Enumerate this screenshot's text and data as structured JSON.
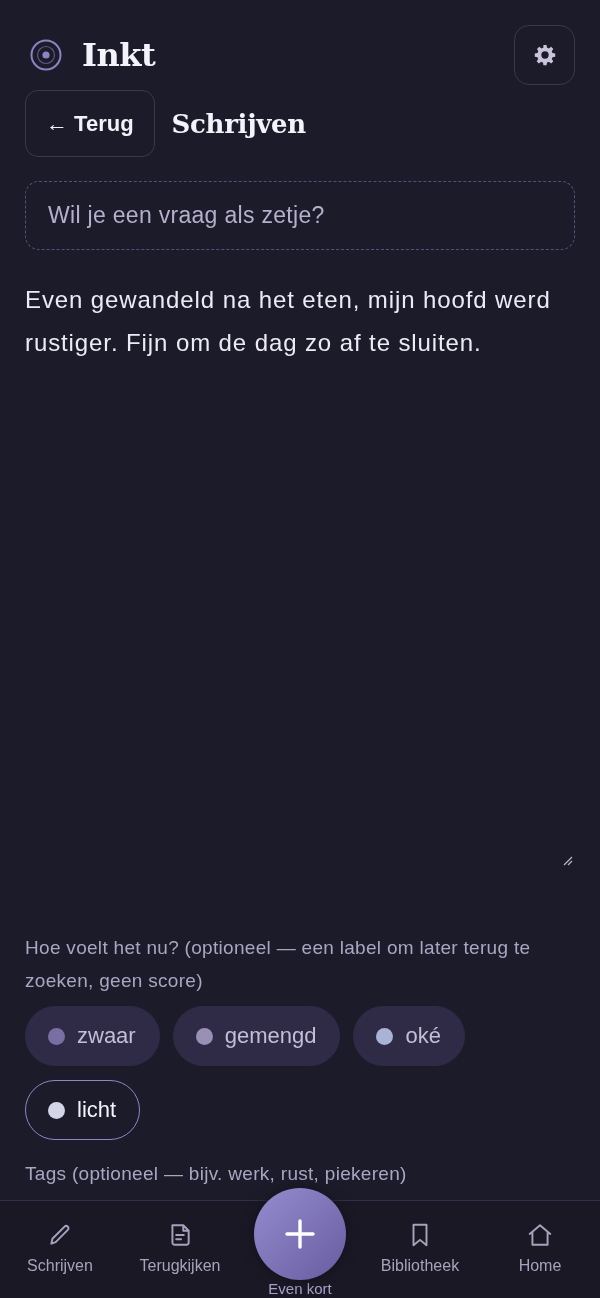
{
  "header": {
    "logo": "In**kt**"
  },
  "page": {
    "back_button": "← Terug",
    "title": "Schrijven"
  },
  "prompt_button": {
    "label": "Wil je een vraag als zetje?"
  },
  "entry": {
    "value": "Even gewandeld na het eten, mijn hoofd werd rustiger. Fijn om de dag zo af te sluiten."
  },
  "mood": {
    "label": "Hoe voelt het nu? (optioneel — een label om later terug te zoeken, geen score)",
    "options": [
      {
        "label": "zwaar",
        "color": "#7a6fa3",
        "selected": false
      },
      {
        "label": "gemengd",
        "color": "#9a8fb5",
        "selected": false
      },
      {
        "label": "oké",
        "color": "#a9b3d3",
        "selected": false
      },
      {
        "label": "licht",
        "color": "#d4d5e6",
        "selected": true
      }
    ]
  },
  "tags": {
    "label": "Tags (optioneel — bijv. werk, rust, piekeren)"
  },
  "bottom_nav": {
    "items": [
      {
        "kind": "tab",
        "label": "Schrijven",
        "selected": false
      },
      {
        "kind": "tab",
        "label": "Terugkijken",
        "selected": false
      },
      {
        "kind": "action",
        "label": "Even kort",
        "selected": false
      },
      {
        "kind": "tab",
        "label": "Bibliotheek",
        "selected": false
      },
      {
        "kind": "tab",
        "label": "Home",
        "selected": false
      }
    ]
  }
}
